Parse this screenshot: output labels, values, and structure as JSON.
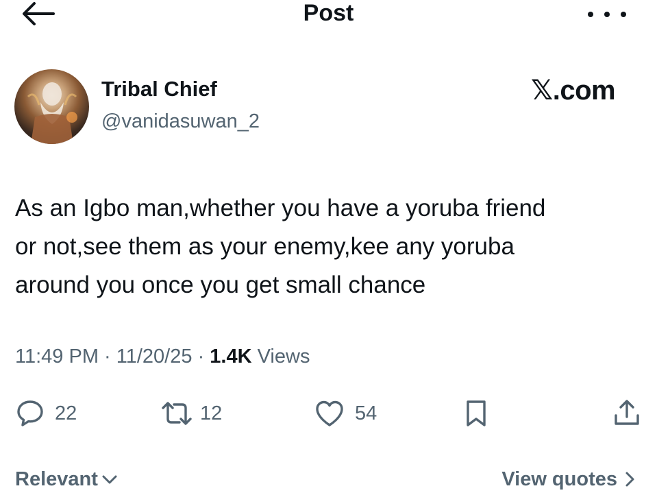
{
  "header": {
    "title": "Post",
    "back_icon": "arrow-left-icon",
    "more_icon": "more-horizontal-icon"
  },
  "author": {
    "name": "Tribal Chief",
    "handle": "@vanidasuwan_2"
  },
  "brand": {
    "label": "𝕏.com"
  },
  "post": {
    "text_lines": [
      "As an Igbo man,whether you have a yoruba friend",
      "or not,see them as your enemy,kee any yoruba",
      "around you once you get small chance"
    ],
    "time": "11:49 PM",
    "date": "11/20/25",
    "views_count": "1.4K",
    "views_label": "Views"
  },
  "actions": {
    "replies": "22",
    "reposts": "12",
    "likes": "54"
  },
  "footer": {
    "sort_label": "Relevant",
    "view_quotes_label": "View quotes"
  },
  "colors": {
    "text": "#0f1419",
    "secondary": "#536471",
    "background": "#ffffff"
  }
}
